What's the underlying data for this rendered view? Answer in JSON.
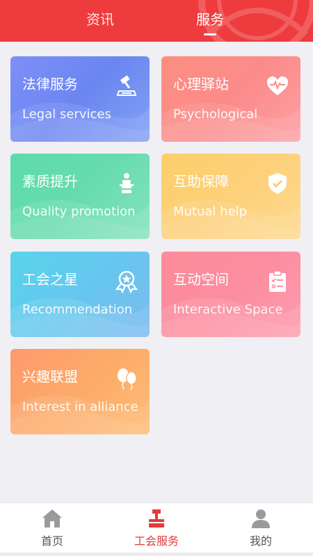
{
  "header": {
    "tabs": [
      {
        "label": "资讯",
        "active": false
      },
      {
        "label": "服务",
        "active": true
      }
    ],
    "colors": {
      "background": "#ee3b3d"
    }
  },
  "services": [
    {
      "title": "法律服务",
      "subtitle": "Legal services",
      "icon": "gavel-icon",
      "color": "#7e8ff8"
    },
    {
      "title": "心理驿站",
      "subtitle": "Psychological",
      "icon": "heart-pulse-icon",
      "color": "#fc8e80"
    },
    {
      "title": "素质提升",
      "subtitle": "Quality promotion",
      "icon": "podium-icon",
      "color": "#5edba8"
    },
    {
      "title": "互助保障",
      "subtitle": "Mutual help",
      "icon": "shield-check-icon",
      "color": "#fccf6a"
    },
    {
      "title": "工会之星",
      "subtitle": "Recommendation",
      "icon": "medal-star-icon",
      "color": "#59d3ec"
    },
    {
      "title": "互动空间",
      "subtitle": "Interactive Space",
      "icon": "clipboard-icon",
      "color": "#fd8b98"
    },
    {
      "title": "兴趣联盟",
      "subtitle": "Interest in alliance",
      "icon": "balloons-icon",
      "color": "#fd9a6e"
    }
  ],
  "bottom_nav": [
    {
      "label": "首页",
      "icon": "home-icon",
      "active": false
    },
    {
      "label": "工会服务",
      "icon": "union-service-icon",
      "active": true
    },
    {
      "label": "我的",
      "icon": "user-icon",
      "active": false
    }
  ]
}
